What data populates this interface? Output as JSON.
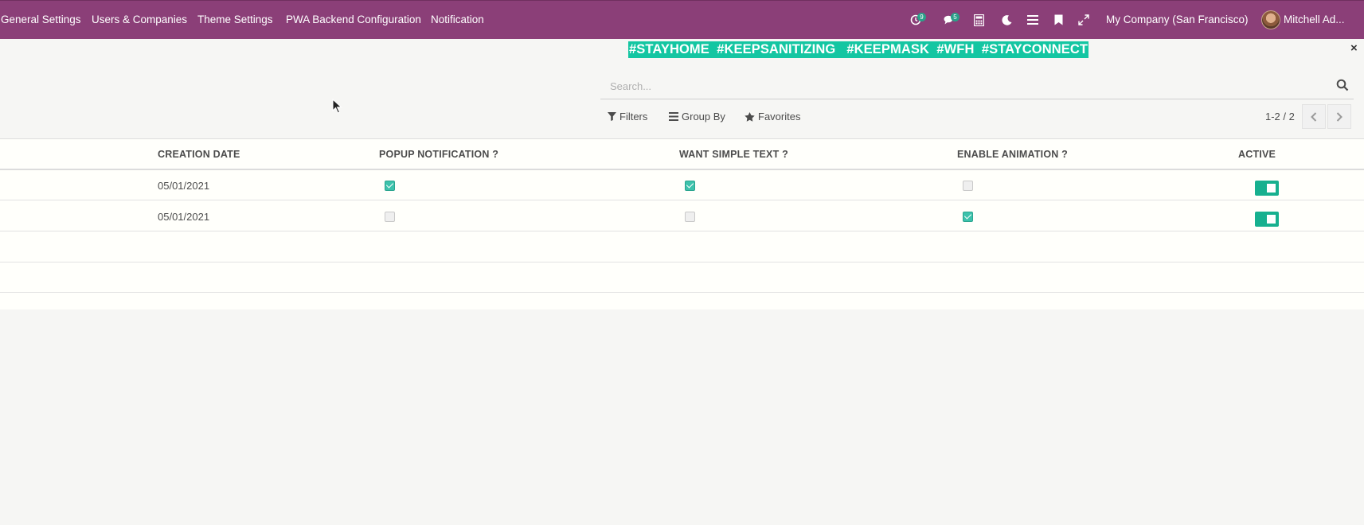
{
  "nav": {
    "items": [
      "General Settings",
      "Users & Companies",
      "Theme Settings",
      "PWA Backend Configuration",
      "Notification"
    ]
  },
  "systray": {
    "activity_count": "9",
    "message_count": "5",
    "company": "My Company (San Francisco)",
    "user": "Mitchell Ad..."
  },
  "banner": {
    "text": "#STAYHOME  #KEEPSANITIZING   #KEEPMASK  #WFH  #STAYCONNECT",
    "close": "×"
  },
  "search": {
    "placeholder": "Search..."
  },
  "controls": {
    "filters": "Filters",
    "group_by": "Group By",
    "favorites": "Favorites",
    "pager": "1-2 / 2"
  },
  "table": {
    "columns": [
      "CREATION DATE",
      "POPUP NOTIFICATION ?",
      "WANT SIMPLE TEXT ?",
      "ENABLE ANIMATION ?",
      "ACTIVE"
    ],
    "rows": [
      {
        "creation_date": "05/01/2021",
        "popup": true,
        "simple_text": true,
        "animation": false,
        "active": true
      },
      {
        "creation_date": "05/01/2021",
        "popup": false,
        "simple_text": false,
        "animation": true,
        "active": true
      }
    ]
  },
  "colors": {
    "topbar": "#8b3f78",
    "accent": "#14c6a2",
    "badge": "#2aa089"
  }
}
